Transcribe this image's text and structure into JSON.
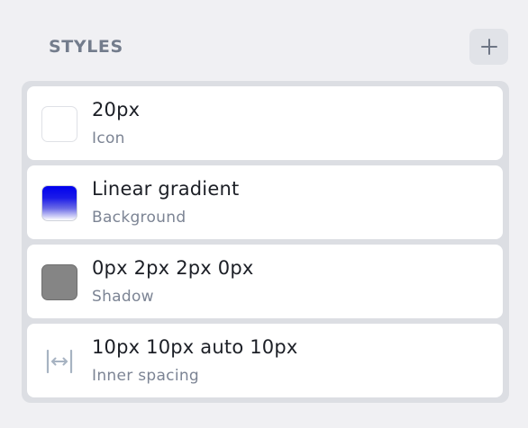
{
  "header": {
    "title": "STYLES",
    "add_button_icon": "plus-icon"
  },
  "styles": [
    {
      "value": "20px",
      "label": "Icon",
      "swatch": "empty"
    },
    {
      "value": "Linear gradient",
      "label": "Background",
      "swatch": "gradient",
      "colors": [
        "#0000ee",
        "#ffffff"
      ]
    },
    {
      "value": "0px 2px 2px 0px",
      "label": "Shadow",
      "swatch": "gray",
      "color": "#858585"
    },
    {
      "value": "10px 10px auto 10px",
      "label": "Inner spacing",
      "swatch": "horizontal-spacing-icon"
    }
  ],
  "colors": {
    "background": "#f0f0f3",
    "list_background": "#dcdee3",
    "card": "#ffffff",
    "title_text": "#1c1f26",
    "subtitle_text": "#7c8494",
    "header_text": "#737c8c",
    "icon": "#a7b3c2"
  }
}
